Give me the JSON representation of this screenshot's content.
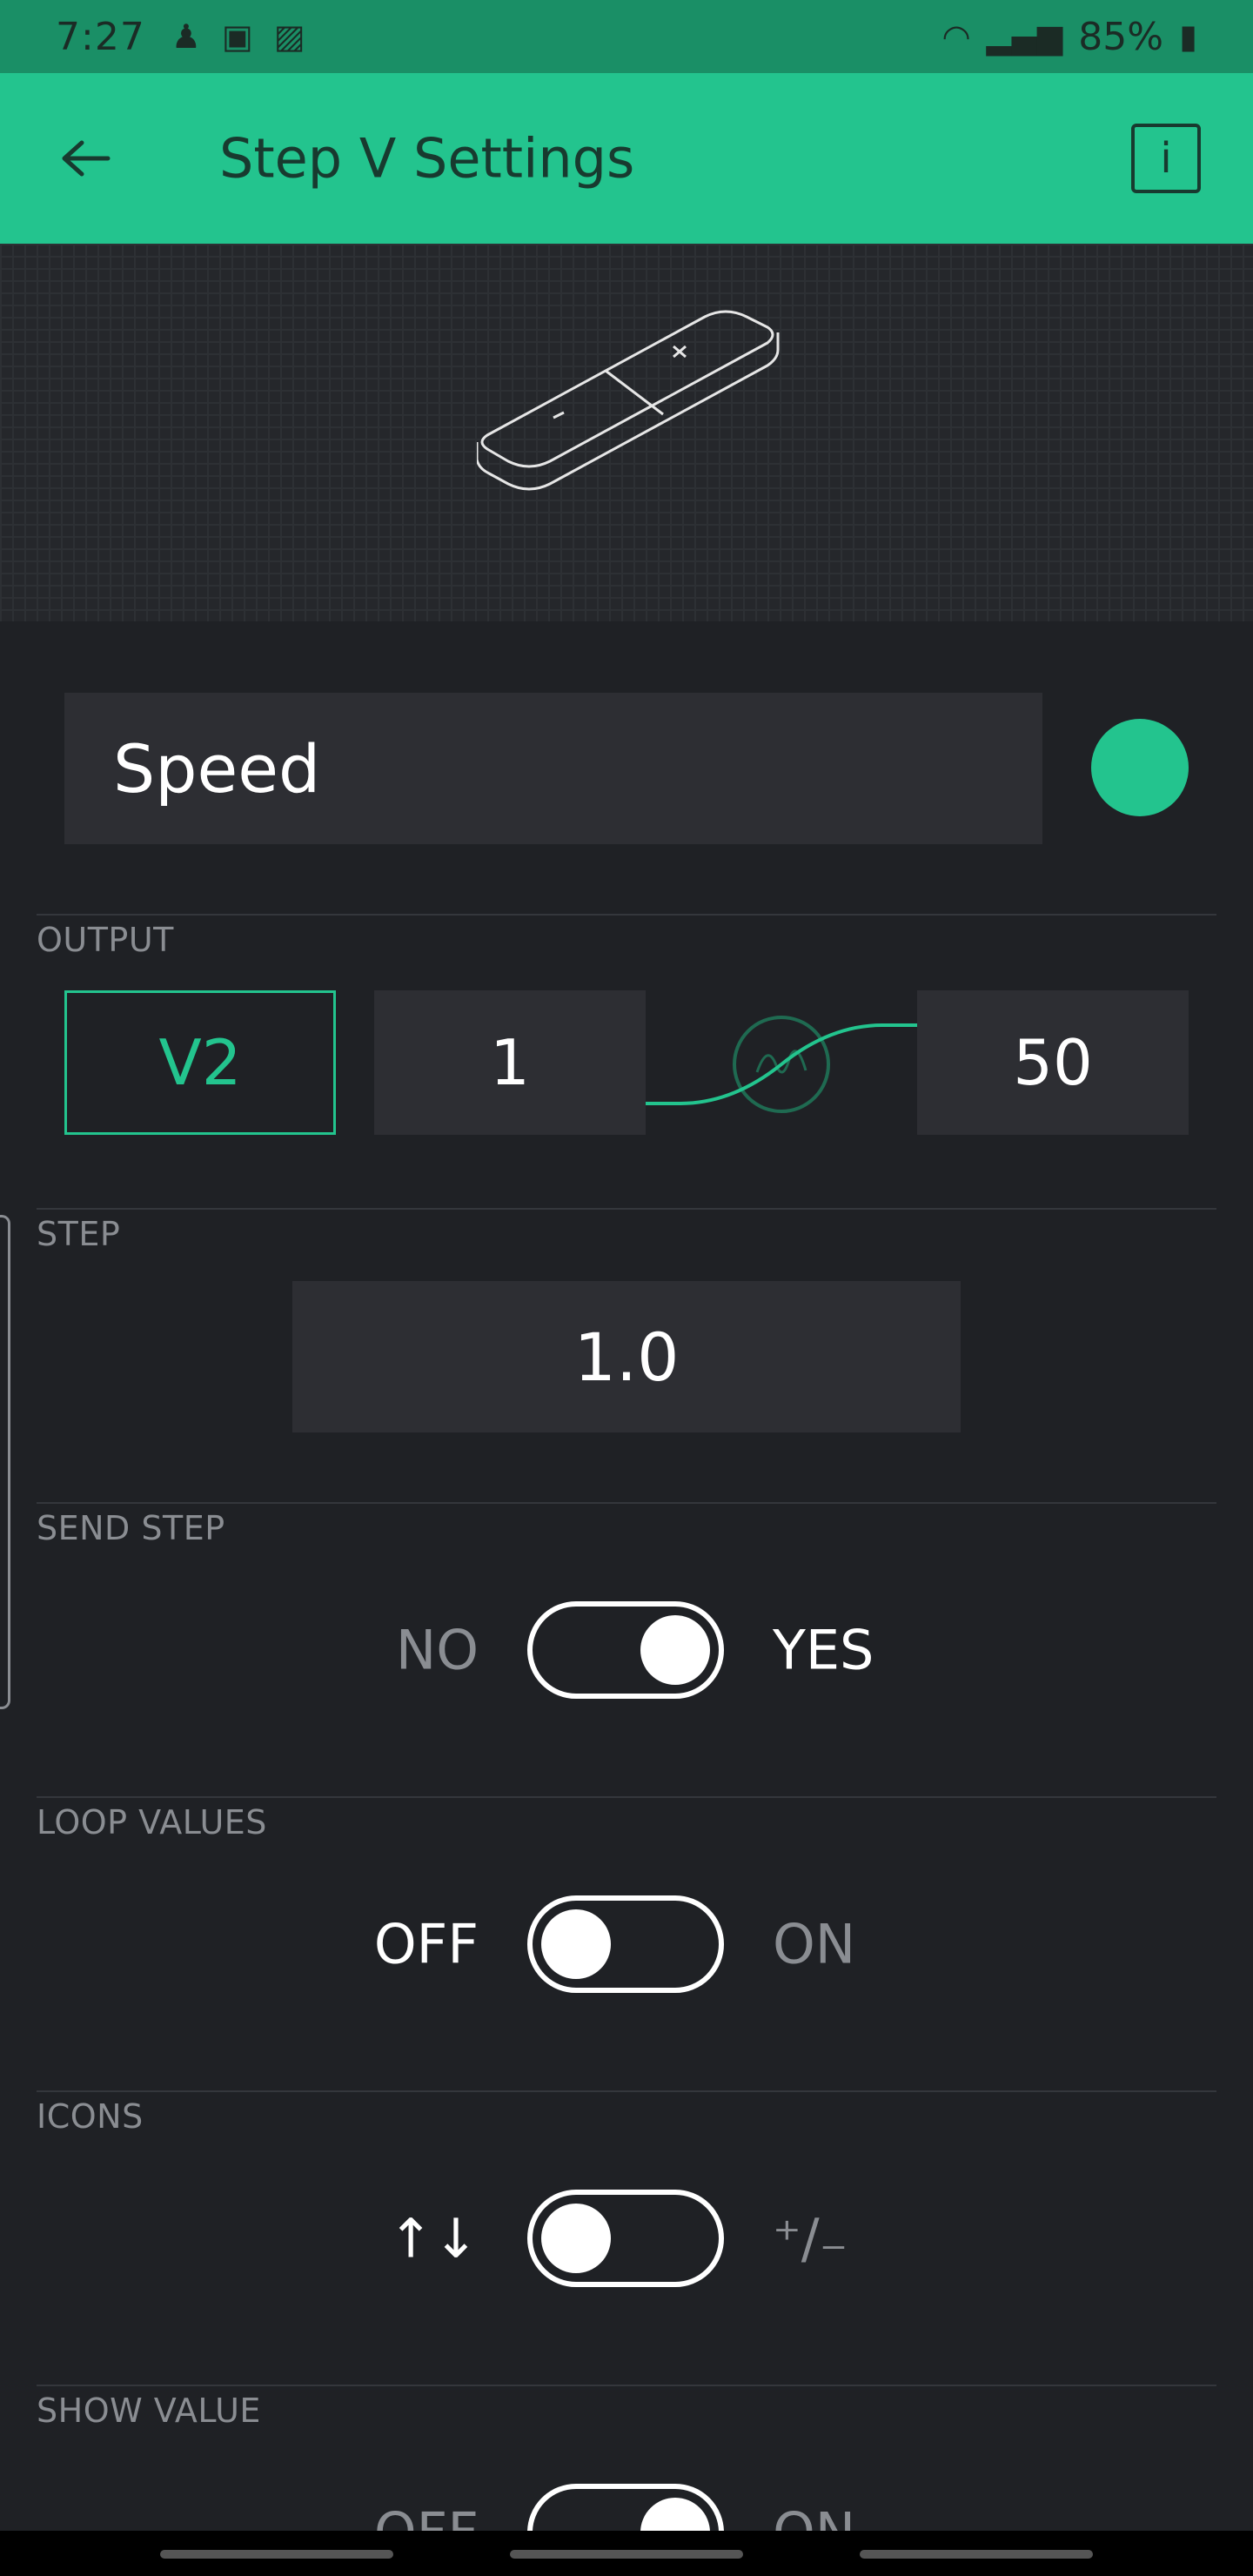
{
  "status_bar": {
    "time": "7:27",
    "battery": "85%",
    "icons": [
      "person-icon",
      "cast-icon",
      "image-icon",
      "wifi-icon",
      "signal-icon",
      "battery-icon"
    ]
  },
  "app_bar": {
    "title": "Step V Settings",
    "info_label": "i"
  },
  "widget_name": "Speed",
  "accent_color": "#23c48e",
  "output": {
    "label": "OUTPUT",
    "pin": "V2",
    "min": "1",
    "max": "50"
  },
  "step": {
    "label": "STEP",
    "value": "1.0"
  },
  "send_step": {
    "label": "SEND STEP",
    "left": "NO",
    "right": "YES",
    "on": true
  },
  "loop_values": {
    "label": "LOOP VALUES",
    "left": "OFF",
    "right": "ON",
    "on": false
  },
  "icons_setting": {
    "label": "ICONS",
    "left": "↑↓",
    "right": "⁺/₋",
    "on": false
  },
  "show_value": {
    "label": "SHOW VALUE",
    "left": "OFF",
    "right": "ON",
    "on": true
  }
}
